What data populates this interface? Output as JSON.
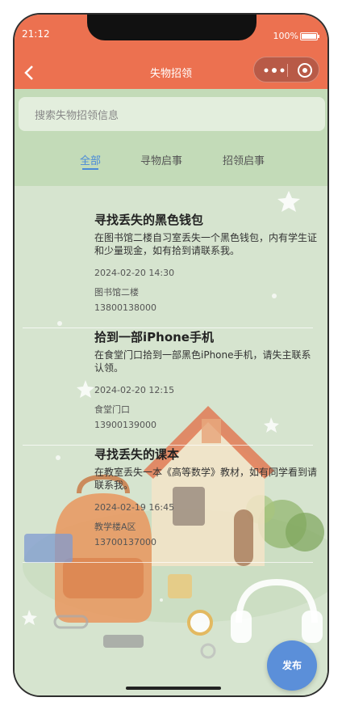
{
  "status_bar": {
    "time": "21:12",
    "battery_percent": "100%"
  },
  "nav": {
    "title": "失物招领",
    "back_icon": "chevron-left-icon",
    "more_icon": "more-dots-icon",
    "close_icon": "target-icon"
  },
  "search": {
    "placeholder": "搜索失物招领信息"
  },
  "tabs": [
    {
      "label": "全部",
      "active": true
    },
    {
      "label": "寻物启事",
      "active": false
    },
    {
      "label": "招领启事",
      "active": false
    }
  ],
  "items": [
    {
      "title": "寻找丢失的黑色钱包",
      "description": "在图书馆二楼自习室丢失一个黑色钱包，内有学生证和少量现金，如有拾到请联系我。",
      "time": "2024-02-20 14:30",
      "location": "图书馆二楼",
      "phone": "13800138000"
    },
    {
      "title": "拾到一部iPhone手机",
      "description": "在食堂门口拾到一部黑色iPhone手机，请失主联系认领。",
      "time": "2024-02-20 12:15",
      "location": "食堂门口",
      "phone": "13900139000"
    },
    {
      "title": "寻找丢失的课本",
      "description": "在教室丢失一本《高等数学》教材，如有同学看到请联系我。",
      "time": "2024-02-19 16:45",
      "location": "教学楼A区",
      "phone": "13700137000"
    }
  ],
  "fab": {
    "label": "发布"
  },
  "colors": {
    "header": "#ec7150",
    "accent": "#4a8ad8",
    "fab": "#5b8fd9"
  }
}
